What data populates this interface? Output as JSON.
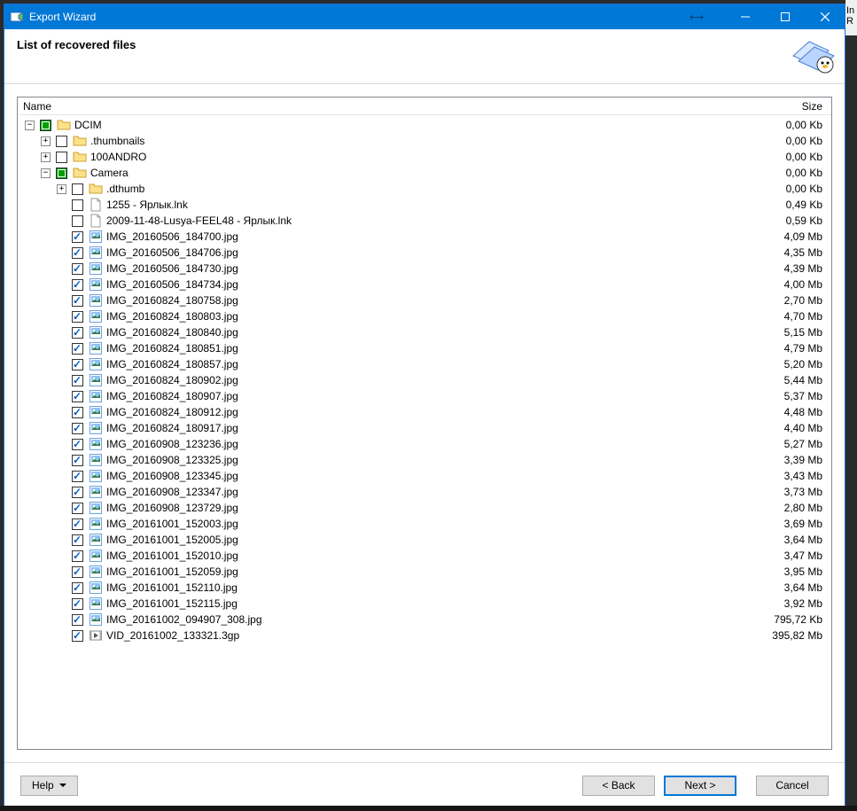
{
  "window": {
    "title": "Export Wizard"
  },
  "header": {
    "title": "List of recovered files"
  },
  "columns": {
    "name": "Name",
    "size": "Size"
  },
  "tree": [
    {
      "indent": 0,
      "expander": "minus",
      "check": "partial",
      "icon": "folder",
      "label": "DCIM",
      "size": "0,00 Kb"
    },
    {
      "indent": 1,
      "expander": "plus",
      "check": "empty",
      "icon": "folder",
      "label": ".thumbnails",
      "size": "0,00 Kb"
    },
    {
      "indent": 1,
      "expander": "plus",
      "check": "empty",
      "icon": "folder",
      "label": "100ANDRO",
      "size": "0,00 Kb"
    },
    {
      "indent": 1,
      "expander": "minus",
      "check": "partial",
      "icon": "folder",
      "label": "Camera",
      "size": "0,00 Kb"
    },
    {
      "indent": 2,
      "expander": "plus",
      "check": "empty",
      "icon": "folder",
      "label": ".dthumb",
      "size": "0,00 Kb"
    },
    {
      "indent": 2,
      "expander": "none",
      "check": "empty",
      "icon": "file",
      "label": "1255 - Ярлык.lnk",
      "size": "0,49 Kb"
    },
    {
      "indent": 2,
      "expander": "none",
      "check": "empty",
      "icon": "file",
      "label": "2009-11-48-Lusya-FEEL48 - Ярлык.lnk",
      "size": "0,59 Kb"
    },
    {
      "indent": 2,
      "expander": "none",
      "check": "checked",
      "icon": "image",
      "label": "IMG_20160506_184700.jpg",
      "size": "4,09 Mb"
    },
    {
      "indent": 2,
      "expander": "none",
      "check": "checked",
      "icon": "image",
      "label": "IMG_20160506_184706.jpg",
      "size": "4,35 Mb"
    },
    {
      "indent": 2,
      "expander": "none",
      "check": "checked",
      "icon": "image",
      "label": "IMG_20160506_184730.jpg",
      "size": "4,39 Mb"
    },
    {
      "indent": 2,
      "expander": "none",
      "check": "checked",
      "icon": "image",
      "label": "IMG_20160506_184734.jpg",
      "size": "4,00 Mb"
    },
    {
      "indent": 2,
      "expander": "none",
      "check": "checked",
      "icon": "image",
      "label": "IMG_20160824_180758.jpg",
      "size": "2,70 Mb"
    },
    {
      "indent": 2,
      "expander": "none",
      "check": "checked",
      "icon": "image",
      "label": "IMG_20160824_180803.jpg",
      "size": "4,70 Mb"
    },
    {
      "indent": 2,
      "expander": "none",
      "check": "checked",
      "icon": "image",
      "label": "IMG_20160824_180840.jpg",
      "size": "5,15 Mb"
    },
    {
      "indent": 2,
      "expander": "none",
      "check": "checked",
      "icon": "image",
      "label": "IMG_20160824_180851.jpg",
      "size": "4,79 Mb"
    },
    {
      "indent": 2,
      "expander": "none",
      "check": "checked",
      "icon": "image",
      "label": "IMG_20160824_180857.jpg",
      "size": "5,20 Mb"
    },
    {
      "indent": 2,
      "expander": "none",
      "check": "checked",
      "icon": "image",
      "label": "IMG_20160824_180902.jpg",
      "size": "5,44 Mb"
    },
    {
      "indent": 2,
      "expander": "none",
      "check": "checked",
      "icon": "image",
      "label": "IMG_20160824_180907.jpg",
      "size": "5,37 Mb"
    },
    {
      "indent": 2,
      "expander": "none",
      "check": "checked",
      "icon": "image",
      "label": "IMG_20160824_180912.jpg",
      "size": "4,48 Mb"
    },
    {
      "indent": 2,
      "expander": "none",
      "check": "checked",
      "icon": "image",
      "label": "IMG_20160824_180917.jpg",
      "size": "4,40 Mb"
    },
    {
      "indent": 2,
      "expander": "none",
      "check": "checked",
      "icon": "image",
      "label": "IMG_20160908_123236.jpg",
      "size": "5,27 Mb"
    },
    {
      "indent": 2,
      "expander": "none",
      "check": "checked",
      "icon": "image",
      "label": "IMG_20160908_123325.jpg",
      "size": "3,39 Mb"
    },
    {
      "indent": 2,
      "expander": "none",
      "check": "checked",
      "icon": "image",
      "label": "IMG_20160908_123345.jpg",
      "size": "3,43 Mb"
    },
    {
      "indent": 2,
      "expander": "none",
      "check": "checked",
      "icon": "image",
      "label": "IMG_20160908_123347.jpg",
      "size": "3,73 Mb"
    },
    {
      "indent": 2,
      "expander": "none",
      "check": "checked",
      "icon": "image",
      "label": "IMG_20160908_123729.jpg",
      "size": "2,80 Mb"
    },
    {
      "indent": 2,
      "expander": "none",
      "check": "checked",
      "icon": "image",
      "label": "IMG_20161001_152003.jpg",
      "size": "3,69 Mb"
    },
    {
      "indent": 2,
      "expander": "none",
      "check": "checked",
      "icon": "image",
      "label": "IMG_20161001_152005.jpg",
      "size": "3,64 Mb"
    },
    {
      "indent": 2,
      "expander": "none",
      "check": "checked",
      "icon": "image",
      "label": "IMG_20161001_152010.jpg",
      "size": "3,47 Mb"
    },
    {
      "indent": 2,
      "expander": "none",
      "check": "checked",
      "icon": "image",
      "label": "IMG_20161001_152059.jpg",
      "size": "3,95 Mb"
    },
    {
      "indent": 2,
      "expander": "none",
      "check": "checked",
      "icon": "image",
      "label": "IMG_20161001_152110.jpg",
      "size": "3,64 Mb"
    },
    {
      "indent": 2,
      "expander": "none",
      "check": "checked",
      "icon": "image",
      "label": "IMG_20161001_152115.jpg",
      "size": "3,92 Mb"
    },
    {
      "indent": 2,
      "expander": "none",
      "check": "checked",
      "icon": "image",
      "label": "IMG_20161002_094907_308.jpg",
      "size": "795,72 Kb"
    },
    {
      "indent": 2,
      "expander": "none",
      "check": "checked",
      "icon": "video",
      "label": "VID_20161002_133321.3gp",
      "size": "395,82 Mb"
    }
  ],
  "footer": {
    "help": "Help",
    "back": "< Back",
    "next": "Next >",
    "cancel": "Cancel"
  },
  "behind": {
    "line1": "In",
    "line2": "R"
  }
}
